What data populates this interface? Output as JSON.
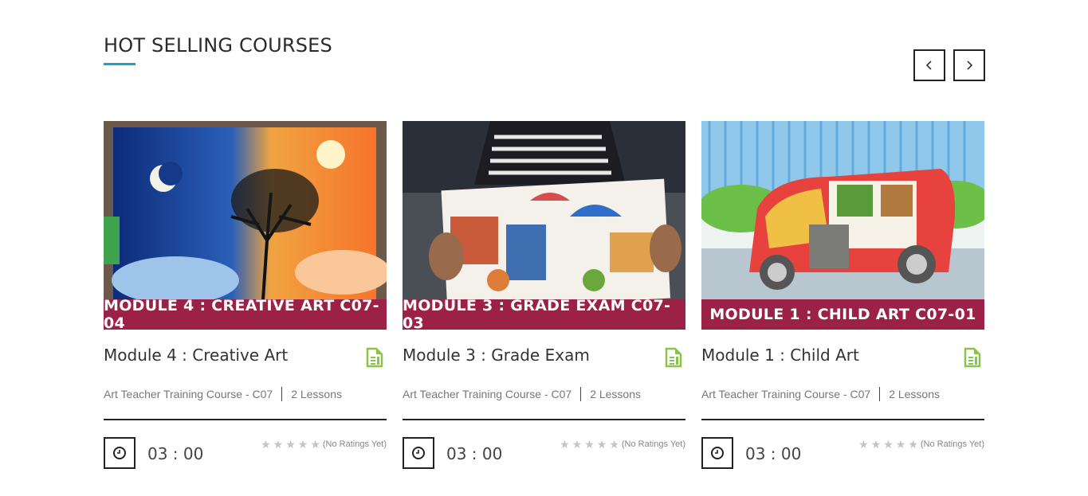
{
  "section": {
    "title": "HOT SELLING COURSES"
  },
  "colors": {
    "accent": "#1ba0c9",
    "banner": "#9b2246",
    "doc_icon": "#8bc34a",
    "star": "#c4c4c4"
  },
  "nav": {
    "prev_icon": "chevron-left-icon",
    "next_icon": "chevron-right-icon"
  },
  "courses": [
    {
      "banner": "MODULE 4 : CREATIVE ART C07-04",
      "title": "Module 4 : Creative Art",
      "category": "Art Teacher Training Course - C07",
      "lessons": "2 Lessons",
      "duration": "03 : 00",
      "rating_text": "(No Ratings Yet)",
      "rating_value": 0
    },
    {
      "banner": "MODULE 3 : GRADE EXAM C07-03",
      "title": "Module 3 : Grade Exam",
      "category": "Art Teacher Training Course - C07",
      "lessons": "2 Lessons",
      "duration": "03 : 00",
      "rating_text": "(No Ratings Yet)",
      "rating_value": 0
    },
    {
      "banner": "MODULE 1 : CHILD ART C07-01",
      "title": "Module 1 : Child Art",
      "category": "Art Teacher Training Course - C07",
      "lessons": "2 Lessons",
      "duration": "03 : 00",
      "rating_text": "(No Ratings Yet)",
      "rating_value": 0
    }
  ]
}
